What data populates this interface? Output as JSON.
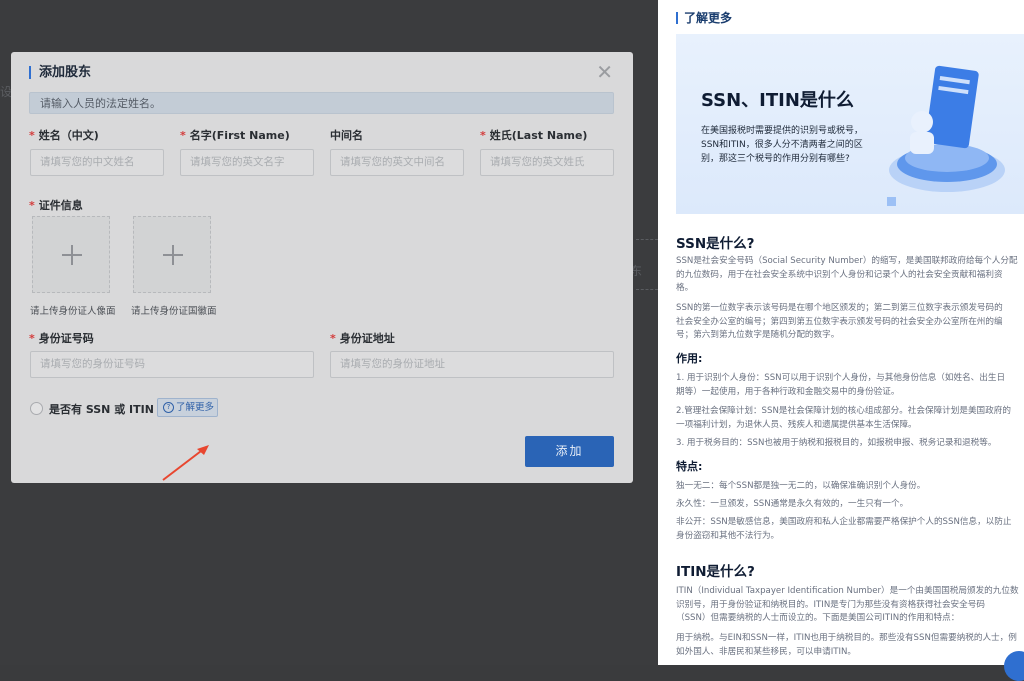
{
  "background": {
    "frag_left": "设",
    "frag_right": "东"
  },
  "dialog": {
    "title": "添加股东",
    "close": "✕",
    "hint": "请输入人员的法定姓名。",
    "fields": {
      "name_cn": {
        "label": "姓名（中文)",
        "placeholder": "请填写您的中文姓名"
      },
      "first_name": {
        "label": "名字(First Name)",
        "placeholder": "请填写您的英文名字"
      },
      "middle_name": {
        "label": "中间名",
        "placeholder": "请填写您的英文中间名"
      },
      "last_name": {
        "label": "姓氏(Last Name)",
        "placeholder": "请填写您的英文姓氏"
      },
      "id_info": {
        "label": "证件信息"
      },
      "upload_front": {
        "caption": "请上传身份证人像面"
      },
      "upload_back": {
        "caption": "请上传身份证国徽面"
      },
      "id_number": {
        "label": "身份证号码",
        "placeholder": "请填写您的身份证号码"
      },
      "id_address": {
        "label": "身份证地址",
        "placeholder": "请填写您的身份证地址"
      }
    },
    "ssn_question": "是否有 SSN 或 ITIN ?",
    "learn_more": "了解更多",
    "learn_more_icon": "?",
    "add_button": "添加"
  },
  "panel": {
    "header": "了解更多",
    "banner": {
      "title": "SSN、ITIN是什么",
      "text": "在美国报税时需要提供的识别号或税号，SSN和ITIN，很多人分不清两者之间的区别，那这三个税号的作用分别有哪些?"
    },
    "ssn": {
      "heading": "SSN是什么?",
      "p1": [
        "SSN是社会安全号码（Social Security Number）的缩写，是美国联邦政府给每个人分配",
        "的九位数码，用于在社会安全系统中识别个人身份和记录个人的社会安全贡献和福利资",
        "格。"
      ],
      "p2": [
        "SSN的第一位数字表示该号码是在哪个地区颁发的；第二到第三位数字表示颁发号码的",
        "社会安全办公室的编号；第四到第五位数字表示颁发号码的社会安全办公室所在州的编",
        "号；第六到第九位数字是随机分配的数字。"
      ],
      "usage_heading": "作用:",
      "u1": [
        "1. 用于识别个人身份：SSN可以用于识别个人身份，与其他身份信息（如姓名、出生日",
        "期等）一起使用，用于各种行政和金融交易中的身份验证。"
      ],
      "u2": [
        "2.管理社会保障计划：SSN是社会保障计划的核心组成部分。社会保障计划是美国政府的",
        "一项福利计划，为退休人员、残疾人和遗属提供基本生活保障。"
      ],
      "u3": [
        "3. 用于税务目的：SSN也被用于纳税和报税目的，如报税申报、税务记录和退税等。"
      ],
      "features_heading": "特点:",
      "f1": [
        "独一无二：每个SSN都是独一无二的，以确保准确识别个人身份。"
      ],
      "f2": [
        "永久性：一旦颁发，SSN通常是永久有效的，一生只有一个。"
      ],
      "f3": [
        "非公开：SSN是敏感信息，美国政府和私人企业都需要严格保护个人的SSN信息，以防止",
        "身份盗窃和其他不法行为。"
      ]
    },
    "itin": {
      "heading": "ITIN是什么?",
      "p1": [
        "ITIN（Individual Taxpayer Identification Number）是一个由美国国税局颁发的九位数",
        "识别号，用于身份验证和纳税目的。ITIN是专门为那些没有资格获得社会安全号码",
        "（SSN）但需要纳税的人士而设立的。下面是美国公司ITIN的作用和特点："
      ],
      "p2": [
        "用于纳税。与EIN和SSN一样，ITIN也用于纳税目的。那些没有SSN但需要纳税的人士，例",
        "如外国人、非居民和某些移民，可以申请ITIN。"
      ]
    }
  }
}
